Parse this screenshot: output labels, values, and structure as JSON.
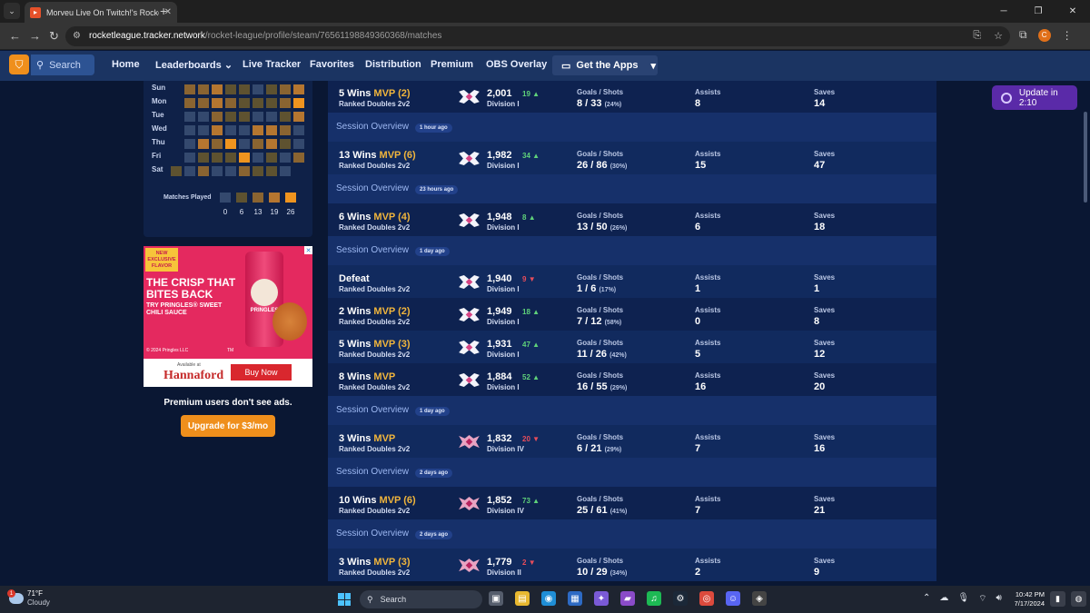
{
  "browser": {
    "tab_title": "Morveu Live On Twitch!'s Rocket",
    "url_host": "rocketleague.tracker.network",
    "url_path": "/rocket-league/profile/steam/76561198849360368/matches"
  },
  "site_nav": {
    "search_label": "Search",
    "links": [
      "Home",
      "Leaderboards",
      "Live Tracker",
      "Favorites",
      "Distribution",
      "Premium",
      "OBS Overlay"
    ],
    "get_apps_label": "Get the Apps"
  },
  "heatmap": {
    "days": [
      "Sun",
      "Mon",
      "Tue",
      "Wed",
      "Thu",
      "Fri",
      "Sat"
    ],
    "matches_played_label": "Matches Played",
    "legend_values": [
      "0",
      "6",
      "13",
      "19",
      "26"
    ],
    "legend_colors": [
      "#34496e",
      "#5e5230",
      "#8a6431",
      "#b57630",
      "#ef941f"
    ],
    "levels": [
      [
        2,
        2,
        3,
        1,
        1,
        0,
        1,
        2,
        3
      ],
      [
        2,
        2,
        3,
        2,
        1,
        1,
        1,
        2,
        4
      ],
      [
        0,
        0,
        2,
        1,
        1,
        0,
        0,
        1,
        3
      ],
      [
        0,
        0,
        3,
        0,
        0,
        3,
        3,
        2,
        0
      ],
      [
        0,
        3,
        2,
        4,
        0,
        2,
        3,
        1,
        0
      ],
      [
        0,
        1,
        1,
        1,
        4,
        0,
        1,
        0,
        2
      ],
      [
        1,
        0,
        2,
        0,
        0,
        2,
        1,
        1,
        0
      ]
    ]
  },
  "ad": {
    "badge": "NEW EXCLUSIVE FLAVOR",
    "headline": "THE CRISP THAT BITES BACK",
    "sub": "TRY PRINGLES® SWEET CHILI SAUCE",
    "copyright": "© 2024 Pringles LLC",
    "tm": "TM",
    "can_brand": "PRINGLES",
    "available": "Available at",
    "store": "Hannaford",
    "buy": "Buy Now"
  },
  "sidebar": {
    "premium_note": "Premium users don't see ads.",
    "upgrade_label": "Upgrade for $3/mo"
  },
  "update_label": "Update in 2:10",
  "stat_labels": {
    "goals_shots": "Goals / Shots",
    "assists": "Assists",
    "saves": "Saves"
  },
  "rows": [
    {
      "kind": "match",
      "result": "5 Wins",
      "mvp": "MVP (2)",
      "mode": "Ranked Doubles 2v2",
      "rating": "2,001",
      "delta": "19",
      "dir": "up",
      "division": "Division I",
      "goals_shots": "8 / 33",
      "pct": "(24%)",
      "assists": "8",
      "saves": "14",
      "tier": "gc"
    },
    {
      "kind": "session",
      "title": "Session Overview",
      "time": "1 hour ago"
    },
    {
      "kind": "match",
      "result": "13 Wins",
      "mvp": "MVP (6)",
      "mode": "Ranked Doubles 2v2",
      "rating": "1,982",
      "delta": "34",
      "dir": "up",
      "division": "Division I",
      "goals_shots": "26 / 86",
      "pct": "(30%)",
      "assists": "15",
      "saves": "47",
      "tier": "gc"
    },
    {
      "kind": "session",
      "title": "Session Overview",
      "time": "23 hours ago"
    },
    {
      "kind": "match",
      "result": "6 Wins",
      "mvp": "MVP (4)",
      "mode": "Ranked Doubles 2v2",
      "rating": "1,948",
      "delta": "8",
      "dir": "up",
      "division": "Division I",
      "goals_shots": "13 / 50",
      "pct": "(26%)",
      "assists": "6",
      "saves": "18",
      "tier": "gc"
    },
    {
      "kind": "session",
      "title": "Session Overview",
      "time": "1 day ago"
    },
    {
      "kind": "match",
      "result": "Defeat",
      "mvp": "",
      "mode": "Ranked Doubles 2v2",
      "rating": "1,940",
      "delta": "9",
      "dir": "down",
      "division": "Division I",
      "goals_shots": "1 / 6",
      "pct": "(17%)",
      "assists": "1",
      "saves": "1",
      "tier": "gc"
    },
    {
      "kind": "match",
      "result": "2 Wins",
      "mvp": "MVP (2)",
      "mode": "Ranked Doubles 2v2",
      "rating": "1,949",
      "delta": "18",
      "dir": "up",
      "division": "Division I",
      "goals_shots": "7 / 12",
      "pct": "(58%)",
      "assists": "0",
      "saves": "8",
      "tier": "gc"
    },
    {
      "kind": "match",
      "result": "5 Wins",
      "mvp": "MVP (3)",
      "mode": "Ranked Doubles 2v2",
      "rating": "1,931",
      "delta": "47",
      "dir": "up",
      "division": "Division I",
      "goals_shots": "11 / 26",
      "pct": "(42%)",
      "assists": "5",
      "saves": "12",
      "tier": "gc"
    },
    {
      "kind": "match",
      "result": "8 Wins",
      "mvp": "MVP",
      "mode": "Ranked Doubles 2v2",
      "rating": "1,884",
      "delta": "52",
      "dir": "up",
      "division": "Division I",
      "goals_shots": "16 / 55",
      "pct": "(29%)",
      "assists": "16",
      "saves": "20",
      "tier": "gc"
    },
    {
      "kind": "session",
      "title": "Session Overview",
      "time": "1 day ago"
    },
    {
      "kind": "match",
      "result": "3 Wins",
      "mvp": "MVP",
      "mode": "Ranked Doubles 2v2",
      "rating": "1,832",
      "delta": "20",
      "dir": "down",
      "division": "Division IV",
      "goals_shots": "6 / 21",
      "pct": "(29%)",
      "assists": "7",
      "saves": "16",
      "tier": "champ"
    },
    {
      "kind": "session",
      "title": "Session Overview",
      "time": "2 days ago"
    },
    {
      "kind": "match",
      "result": "10 Wins",
      "mvp": "MVP (6)",
      "mode": "Ranked Doubles 2v2",
      "rating": "1,852",
      "delta": "73",
      "dir": "up",
      "division": "Division IV",
      "goals_shots": "25 / 61",
      "pct": "(41%)",
      "assists": "7",
      "saves": "21",
      "tier": "champ"
    },
    {
      "kind": "session",
      "title": "Session Overview",
      "time": "2 days ago"
    },
    {
      "kind": "match",
      "result": "3 Wins",
      "mvp": "MVP (3)",
      "mode": "Ranked Doubles 2v2",
      "rating": "1,779",
      "delta": "2",
      "dir": "down",
      "division": "Division II",
      "goals_shots": "10 / 29",
      "pct": "(34%)",
      "assists": "2",
      "saves": "9",
      "tier": "champ"
    }
  ],
  "taskbar": {
    "temp": "71°F",
    "condition": "Cloudy",
    "weather_badge": "1",
    "search_label": "Search",
    "time": "10:42 PM",
    "date": "7/17/2024"
  },
  "colors": {
    "accent_orange": "#ef8f1c",
    "mvp_gold": "#f0b53c",
    "up_green": "#5fd27a",
    "down_red": "#e84d5b"
  }
}
